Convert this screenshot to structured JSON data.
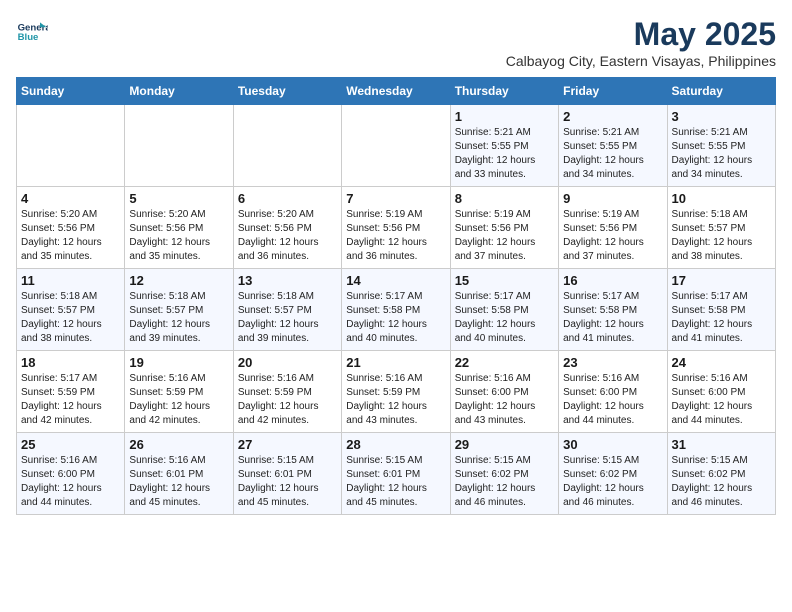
{
  "logo": {
    "line1": "General",
    "line2": "Blue"
  },
  "title": "May 2025",
  "subtitle": "Calbayog City, Eastern Visayas, Philippines",
  "weekdays": [
    "Sunday",
    "Monday",
    "Tuesday",
    "Wednesday",
    "Thursday",
    "Friday",
    "Saturday"
  ],
  "weeks": [
    [
      {
        "day": "",
        "info": ""
      },
      {
        "day": "",
        "info": ""
      },
      {
        "day": "",
        "info": ""
      },
      {
        "day": "",
        "info": ""
      },
      {
        "day": "1",
        "info": "Sunrise: 5:21 AM\nSunset: 5:55 PM\nDaylight: 12 hours\nand 33 minutes."
      },
      {
        "day": "2",
        "info": "Sunrise: 5:21 AM\nSunset: 5:55 PM\nDaylight: 12 hours\nand 34 minutes."
      },
      {
        "day": "3",
        "info": "Sunrise: 5:21 AM\nSunset: 5:55 PM\nDaylight: 12 hours\nand 34 minutes."
      }
    ],
    [
      {
        "day": "4",
        "info": "Sunrise: 5:20 AM\nSunset: 5:56 PM\nDaylight: 12 hours\nand 35 minutes."
      },
      {
        "day": "5",
        "info": "Sunrise: 5:20 AM\nSunset: 5:56 PM\nDaylight: 12 hours\nand 35 minutes."
      },
      {
        "day": "6",
        "info": "Sunrise: 5:20 AM\nSunset: 5:56 PM\nDaylight: 12 hours\nand 36 minutes."
      },
      {
        "day": "7",
        "info": "Sunrise: 5:19 AM\nSunset: 5:56 PM\nDaylight: 12 hours\nand 36 minutes."
      },
      {
        "day": "8",
        "info": "Sunrise: 5:19 AM\nSunset: 5:56 PM\nDaylight: 12 hours\nand 37 minutes."
      },
      {
        "day": "9",
        "info": "Sunrise: 5:19 AM\nSunset: 5:56 PM\nDaylight: 12 hours\nand 37 minutes."
      },
      {
        "day": "10",
        "info": "Sunrise: 5:18 AM\nSunset: 5:57 PM\nDaylight: 12 hours\nand 38 minutes."
      }
    ],
    [
      {
        "day": "11",
        "info": "Sunrise: 5:18 AM\nSunset: 5:57 PM\nDaylight: 12 hours\nand 38 minutes."
      },
      {
        "day": "12",
        "info": "Sunrise: 5:18 AM\nSunset: 5:57 PM\nDaylight: 12 hours\nand 39 minutes."
      },
      {
        "day": "13",
        "info": "Sunrise: 5:18 AM\nSunset: 5:57 PM\nDaylight: 12 hours\nand 39 minutes."
      },
      {
        "day": "14",
        "info": "Sunrise: 5:17 AM\nSunset: 5:58 PM\nDaylight: 12 hours\nand 40 minutes."
      },
      {
        "day": "15",
        "info": "Sunrise: 5:17 AM\nSunset: 5:58 PM\nDaylight: 12 hours\nand 40 minutes."
      },
      {
        "day": "16",
        "info": "Sunrise: 5:17 AM\nSunset: 5:58 PM\nDaylight: 12 hours\nand 41 minutes."
      },
      {
        "day": "17",
        "info": "Sunrise: 5:17 AM\nSunset: 5:58 PM\nDaylight: 12 hours\nand 41 minutes."
      }
    ],
    [
      {
        "day": "18",
        "info": "Sunrise: 5:17 AM\nSunset: 5:59 PM\nDaylight: 12 hours\nand 42 minutes."
      },
      {
        "day": "19",
        "info": "Sunrise: 5:16 AM\nSunset: 5:59 PM\nDaylight: 12 hours\nand 42 minutes."
      },
      {
        "day": "20",
        "info": "Sunrise: 5:16 AM\nSunset: 5:59 PM\nDaylight: 12 hours\nand 42 minutes."
      },
      {
        "day": "21",
        "info": "Sunrise: 5:16 AM\nSunset: 5:59 PM\nDaylight: 12 hours\nand 43 minutes."
      },
      {
        "day": "22",
        "info": "Sunrise: 5:16 AM\nSunset: 6:00 PM\nDaylight: 12 hours\nand 43 minutes."
      },
      {
        "day": "23",
        "info": "Sunrise: 5:16 AM\nSunset: 6:00 PM\nDaylight: 12 hours\nand 44 minutes."
      },
      {
        "day": "24",
        "info": "Sunrise: 5:16 AM\nSunset: 6:00 PM\nDaylight: 12 hours\nand 44 minutes."
      }
    ],
    [
      {
        "day": "25",
        "info": "Sunrise: 5:16 AM\nSunset: 6:00 PM\nDaylight: 12 hours\nand 44 minutes."
      },
      {
        "day": "26",
        "info": "Sunrise: 5:16 AM\nSunset: 6:01 PM\nDaylight: 12 hours\nand 45 minutes."
      },
      {
        "day": "27",
        "info": "Sunrise: 5:15 AM\nSunset: 6:01 PM\nDaylight: 12 hours\nand 45 minutes."
      },
      {
        "day": "28",
        "info": "Sunrise: 5:15 AM\nSunset: 6:01 PM\nDaylight: 12 hours\nand 45 minutes."
      },
      {
        "day": "29",
        "info": "Sunrise: 5:15 AM\nSunset: 6:02 PM\nDaylight: 12 hours\nand 46 minutes."
      },
      {
        "day": "30",
        "info": "Sunrise: 5:15 AM\nSunset: 6:02 PM\nDaylight: 12 hours\nand 46 minutes."
      },
      {
        "day": "31",
        "info": "Sunrise: 5:15 AM\nSunset: 6:02 PM\nDaylight: 12 hours\nand 46 minutes."
      }
    ]
  ]
}
